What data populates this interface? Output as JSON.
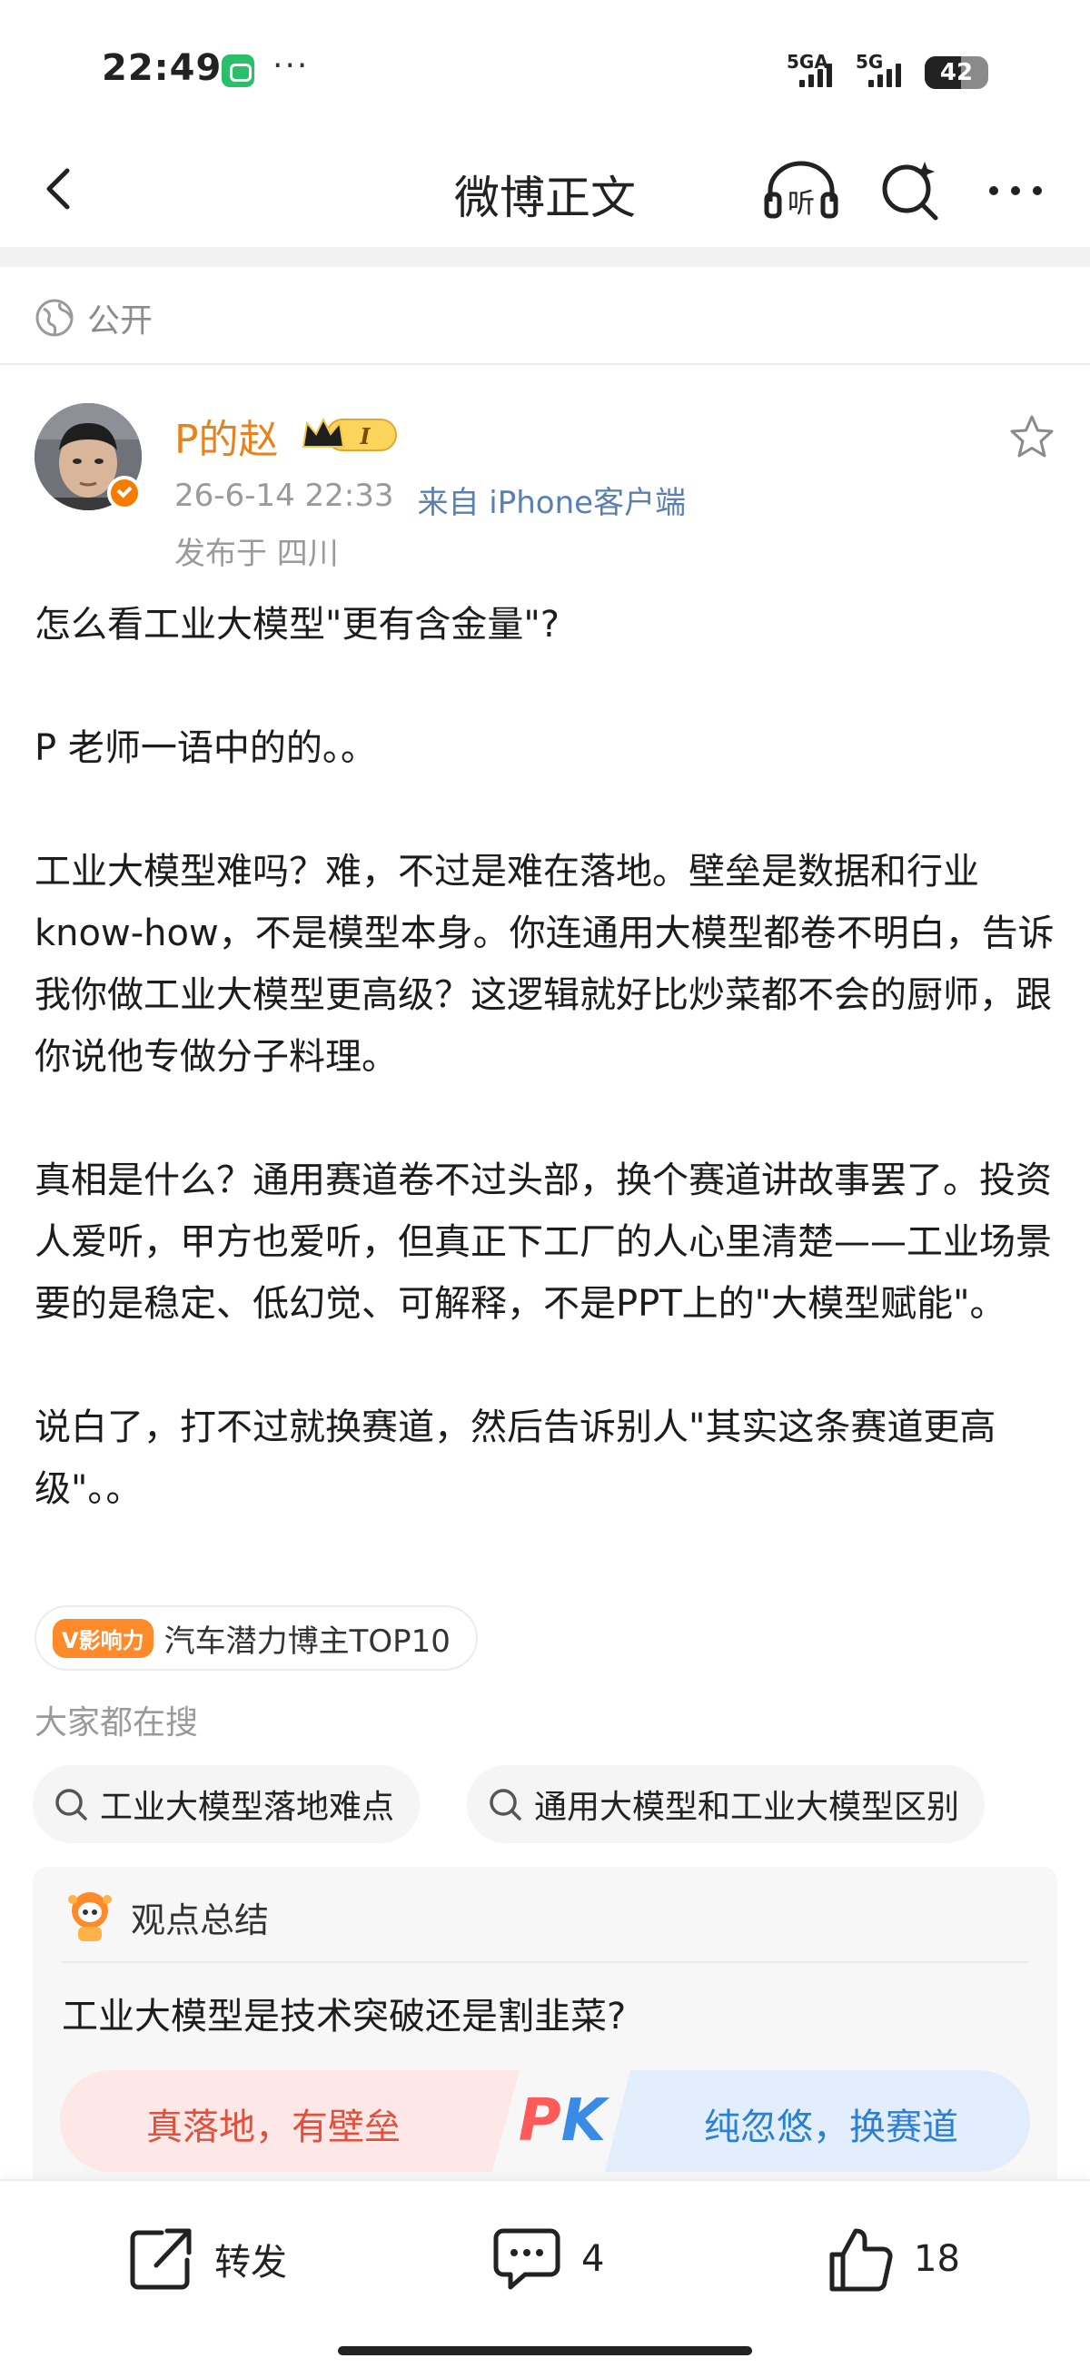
{
  "status_bar": {
    "time": "22:49",
    "more": "···",
    "network_1": "5GA",
    "network_2": "5G",
    "battery": "42"
  },
  "nav": {
    "title": "微博正文",
    "listen_label": "听"
  },
  "post": {
    "visibility": "公开",
    "author": {
      "name": "P的赵",
      "level_badge": "I",
      "accent_color": "#e8821e"
    },
    "date": "26-6-14 22:33",
    "source": "来自 iPhone客户端",
    "location": "发布于 四川",
    "paragraphs": [
      "怎么看工业大模型\"更有含金量\"?",
      "P 老师一语中的的。。",
      "工业大模型难吗？难，不过是难在落地。壁垒是数据和行业know-how，不是模型本身。你连通用大模型都卷不明白，告诉我你做工业大模型更高级？这逻辑就好比炒菜都不会的厨师，跟你说他专做分子料理。",
      "真相是什么？通用赛道卷不过头部，换个赛道讲故事罢了。投资人爱听，甲方也爱听，但真正下工厂的人心里清楚——工业场景要的是稳定、低幻觉、可解释，不是PPT上的\"大模型赋能\"。",
      "说白了，打不过就换赛道，然后告诉别人\"其实这条赛道更高级\"。。"
    ]
  },
  "influence": {
    "tag": "V影响力",
    "text": "汽车潜力博主TOP10"
  },
  "search": {
    "heading": "大家都在搜",
    "items": [
      "工业大模型落地难点",
      "通用大模型和工业大模型区别"
    ]
  },
  "summary": {
    "title": "观点总结",
    "question": "工业大模型是技术突破还是割韭菜?",
    "pk_left": "真落地，有壁垒",
    "pk_mark_p": "P",
    "pk_mark_k": "K",
    "pk_right": "纯忽悠，换赛道"
  },
  "actions": {
    "repost_label": "转发",
    "comment_count": "4",
    "like_count": "18"
  }
}
